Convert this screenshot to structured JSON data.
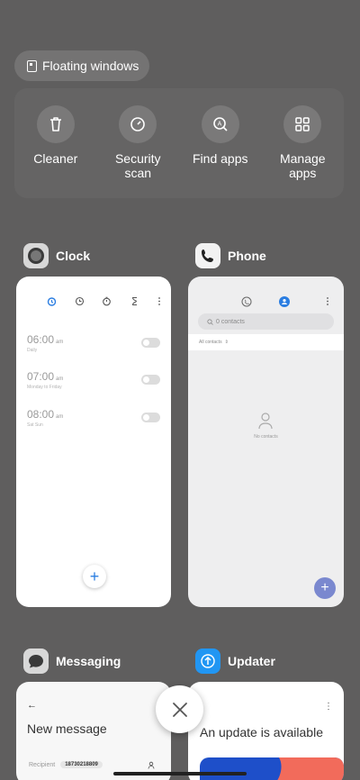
{
  "floating_windows": {
    "label": "Floating windows"
  },
  "quick_actions": [
    {
      "label": "Cleaner",
      "icon": "trash-icon"
    },
    {
      "label": "Security scan",
      "icon": "shield-gauge-icon"
    },
    {
      "label": "Find apps",
      "icon": "find-apps-icon"
    },
    {
      "label": "Manage apps",
      "icon": "grid-icon"
    }
  ],
  "apps": {
    "clock": {
      "name": "Clock",
      "alarms": [
        {
          "time": "06:00",
          "ampm": "am",
          "repeat": "Daily"
        },
        {
          "time": "07:00",
          "ampm": "am",
          "repeat": "Monday to Friday"
        },
        {
          "time": "08:00",
          "ampm": "am",
          "repeat": "Sat Sun"
        }
      ],
      "fab": "+"
    },
    "phone": {
      "name": "Phone",
      "search_placeholder": "0 contacts",
      "filter": "All contacts",
      "empty": "No contacts",
      "fab": "+"
    },
    "messaging": {
      "name": "Messaging",
      "back": "←",
      "title": "New message",
      "recipient_label": "Recipient",
      "recipient_value": "18730218809"
    },
    "updater": {
      "name": "Updater",
      "message": "An update is available",
      "menu": "⋮"
    }
  },
  "close_button": {
    "glyph": "✕"
  },
  "colors": {
    "background": "#5f5e5e",
    "clock_accent": "#2a7de1",
    "phone_fab": "#7a88cf",
    "updater_icon": "#2196f3"
  }
}
